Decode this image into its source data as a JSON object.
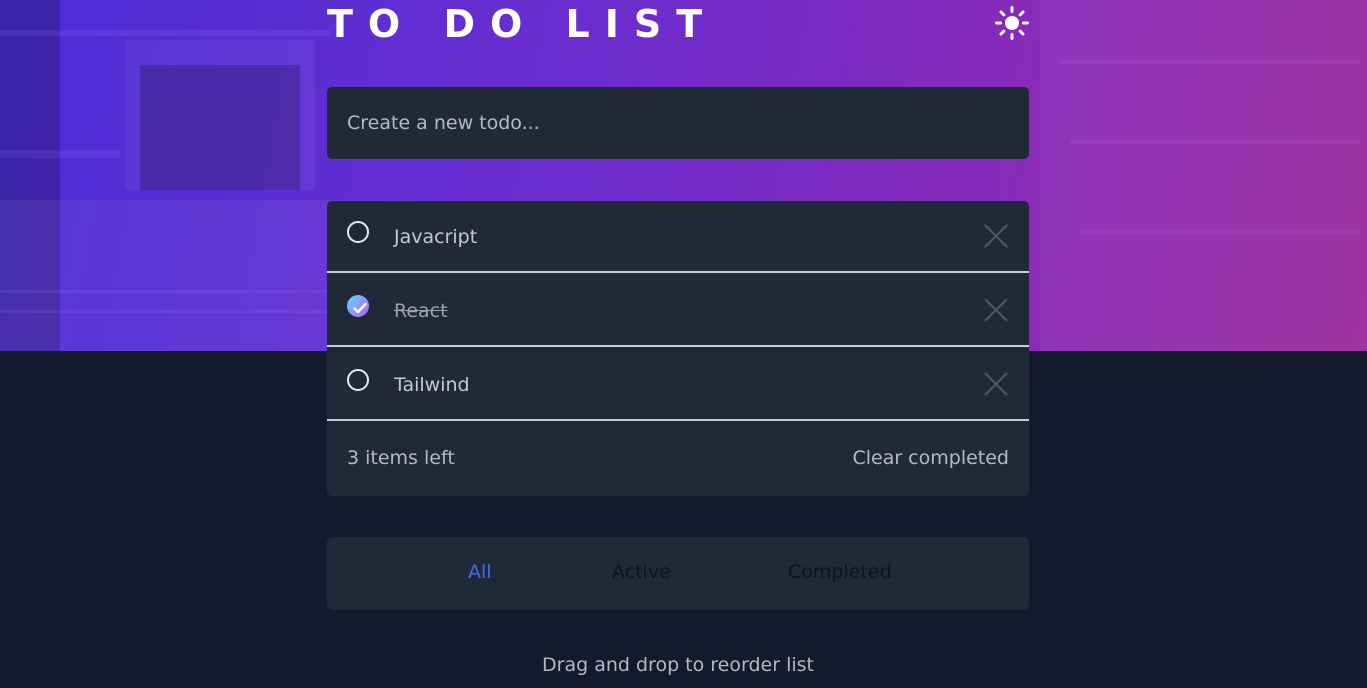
{
  "header": {
    "title": "TO DO LIST",
    "theme_icon": "sun-icon"
  },
  "new_todo": {
    "placeholder": "Create a new todo..."
  },
  "todos": [
    {
      "label": "Javacript",
      "completed": false
    },
    {
      "label": "React",
      "completed": true
    },
    {
      "label": "Tailwind",
      "completed": false
    }
  ],
  "footer": {
    "items_left": "3 items left",
    "clear_completed": "Clear completed"
  },
  "filters": {
    "all": "All",
    "active": "Active",
    "completed": "Completed",
    "selected": "All"
  },
  "hint": "Drag and drop to reorder list",
  "colors": {
    "card": "#1f2937",
    "page": "#131a2b",
    "accent": "#3a6df0",
    "check_start": "#57ddff",
    "check_end": "#c058f3"
  }
}
